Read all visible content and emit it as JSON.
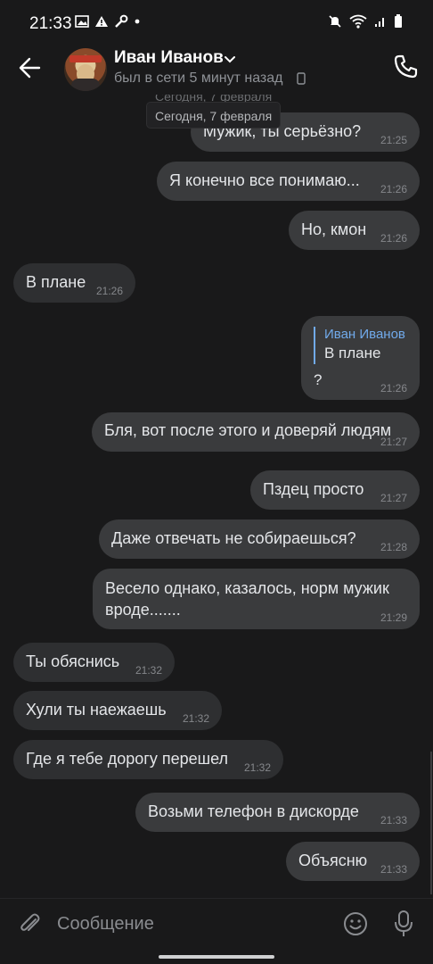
{
  "status_bar": {
    "time": "21:33"
  },
  "header": {
    "contact_name": "Иван Иванов",
    "status": "был в сети 5 минут назад"
  },
  "chat": {
    "ghost_date": "Сегодня, 7 февраля",
    "date_separator": "Сегодня, 7 февраля",
    "messages": [
      {
        "text": "Мужик, ты серьёзно?",
        "time": "21:25",
        "direction": "out"
      },
      {
        "text": "Я конечно все понимаю...",
        "time": "21:26",
        "direction": "out"
      },
      {
        "text": "Но, кмон",
        "time": "21:26",
        "direction": "out"
      },
      {
        "text": "В плане",
        "time": "21:26",
        "direction": "in"
      },
      {
        "reply_author": "Иван Иванов",
        "reply_text": "В плане",
        "text": "?",
        "time": "21:26",
        "direction": "out"
      },
      {
        "text": "Бля, вот после этого и доверяй людям",
        "time": "21:27",
        "direction": "out"
      },
      {
        "text": "Пздец просто",
        "time": "21:27",
        "direction": "out"
      },
      {
        "text": "Даже отвечать не собираешься?",
        "time": "21:28",
        "direction": "out"
      },
      {
        "text": "Весело однако, казалось, норм мужик вроде.......",
        "time": "21:29",
        "direction": "out"
      },
      {
        "text": "Ты обяснись",
        "time": "21:32",
        "direction": "in"
      },
      {
        "text": "Хули ты наежаешь",
        "time": "21:32",
        "direction": "in"
      },
      {
        "text": "Где я тебе дорогу перешел",
        "time": "21:32",
        "direction": "in"
      },
      {
        "text": "Возьми телефон в дискорде",
        "time": "21:33",
        "direction": "out"
      },
      {
        "text": "Объясню",
        "time": "21:33",
        "direction": "out"
      }
    ]
  },
  "composer": {
    "placeholder": "Сообщение"
  },
  "icons": {
    "back": "arrow-left-icon",
    "chevron": "chevron-down-icon",
    "call": "phone-icon",
    "attach": "paperclip-icon",
    "emoji": "smile-icon",
    "mic": "microphone-icon"
  },
  "colors": {
    "accent": "#71aaeb",
    "bubble_out": "#3a3b3d",
    "bubble_in": "#2e2f31",
    "background": "#19191a"
  }
}
